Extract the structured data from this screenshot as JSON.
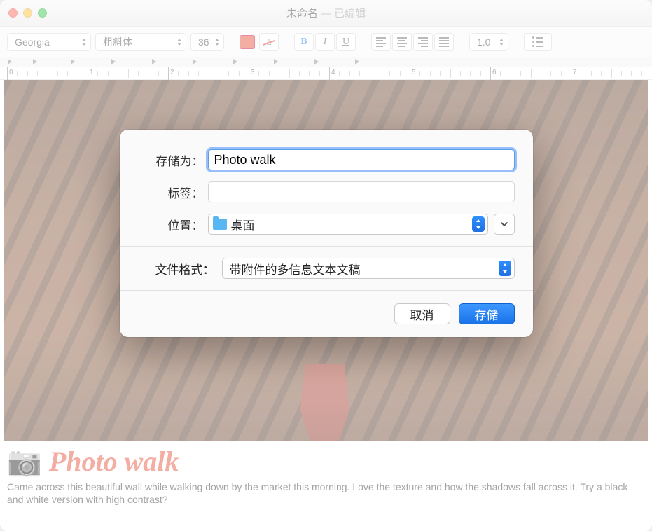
{
  "window": {
    "title_main": "未命名",
    "title_sep": " — ",
    "title_status": "已编辑"
  },
  "toolbar": {
    "font_family": "Georgia",
    "font_style": "粗斜体",
    "font_size": "36",
    "line_spacing": "1.0",
    "color_swatch": "#e74a34"
  },
  "ruler": {
    "labels": [
      "0",
      "1",
      "2",
      "3",
      "4",
      "5",
      "6",
      "7"
    ]
  },
  "document": {
    "camera_emoji": "📷",
    "heading": "Photo walk",
    "body": "Came across this beautiful wall while walking down by the market this morning. Love the texture and how the shadows fall across it. Try a black and white version with high contrast?"
  },
  "save_dialog": {
    "save_as_label": "存储为：",
    "save_as_value": "Photo walk",
    "tags_label": "标签：",
    "tags_value": "",
    "location_label": "位置：",
    "location_value": "桌面",
    "file_format_label": "文件格式：",
    "file_format_value": "带附件的多信息文本文稿",
    "cancel_label": "取消",
    "save_label": "存储"
  }
}
